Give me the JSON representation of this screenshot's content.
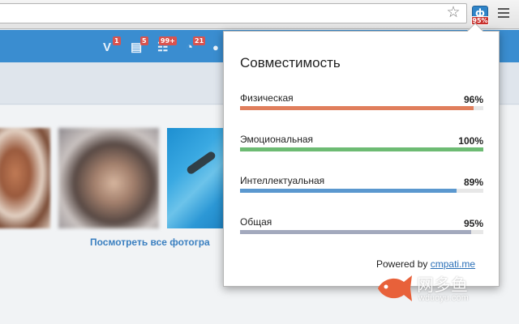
{
  "browser": {
    "extension_badge": "95%",
    "extension_icon": "cmpati-extension-icon",
    "star_icon": "bookmark-star-icon",
    "menu_icon": "hamburger-menu-icon"
  },
  "header": {
    "nav": [
      {
        "icon": "vip-icon",
        "glyph": "V",
        "badge": "1"
      },
      {
        "icon": "messages-icon",
        "glyph": "▤",
        "badge": "5"
      },
      {
        "icon": "events-icon",
        "glyph": "☷",
        "badge": "99+"
      },
      {
        "icon": "guests-icon",
        "glyph": "◔",
        "badge": "21"
      },
      {
        "icon": "friends-icon",
        "glyph": "👤",
        "badge": ""
      }
    ]
  },
  "page": {
    "all_photos_link": "Посмотреть все фотогра"
  },
  "popup": {
    "title": "Совместимость",
    "metrics": [
      {
        "label": "Физическая",
        "value": "96%",
        "fraction": 0.96,
        "color": "#e07e5c"
      },
      {
        "label": "Эмоциональная",
        "value": "100%",
        "fraction": 1.0,
        "color": "#6dbb73"
      },
      {
        "label": "Интеллектуальная",
        "value": "89%",
        "fraction": 0.89,
        "color": "#5b98cf"
      },
      {
        "label": "Общая",
        "value": "95%",
        "fraction": 0.95,
        "color": "#a3a9bd"
      }
    ],
    "powered_by": "Powered by",
    "powered_link": "cmpati.me"
  },
  "watermark": {
    "cn": "网多鱼",
    "en": "wduoyu.com"
  },
  "colors": {
    "header_blue": "#3a8dd0",
    "link_blue": "#2a6fb7",
    "badge_red": "#d9534f"
  }
}
